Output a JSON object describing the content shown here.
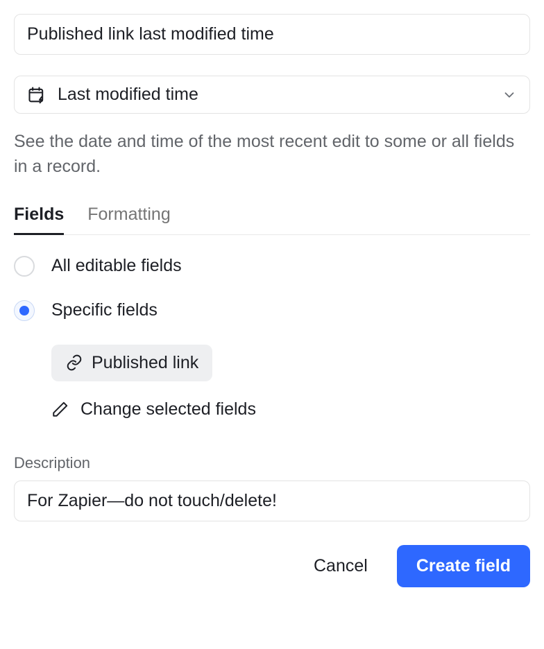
{
  "field_name": "Published link last modified time",
  "type_selector": {
    "label": "Last modified time"
  },
  "help_text": "See the date and time of the most recent edit to some or all fields in a record.",
  "tabs": {
    "fields": "Fields",
    "formatting": "Formatting",
    "active": "fields"
  },
  "options": {
    "all": {
      "label": "All editable fields",
      "checked": false
    },
    "specific": {
      "label": "Specific fields",
      "checked": true
    },
    "selected_field_chip": "Published link",
    "change_label": "Change selected fields"
  },
  "description": {
    "label": "Description",
    "value": "For Zapier—do not touch/delete!"
  },
  "buttons": {
    "cancel": "Cancel",
    "create": "Create field"
  }
}
